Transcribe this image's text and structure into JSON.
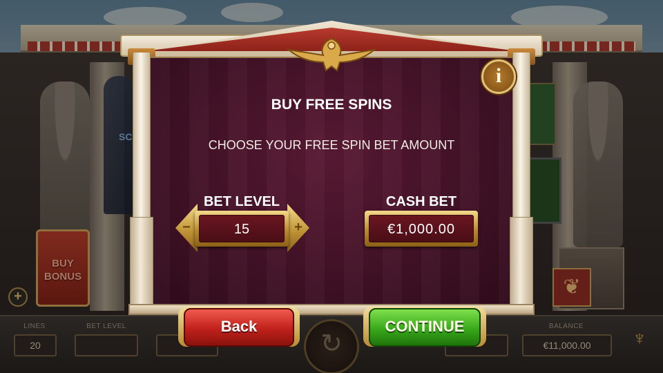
{
  "dialog": {
    "title": "BUY FREE SPINS",
    "subtitle": "CHOOSE YOUR FREE SPIN BET AMOUNT",
    "bet_level": {
      "label": "BET LEVEL",
      "value": "15",
      "decrease_icon": "minus-icon",
      "increase_icon": "plus-icon",
      "decrease_glyph": "−",
      "increase_glyph": "+"
    },
    "cash_bet": {
      "label": "CASH BET",
      "value": "€1,000.00"
    },
    "info_glyph": "i",
    "buttons": {
      "back": "Back",
      "continue": "CONTINUE"
    }
  },
  "game": {
    "buy_bonus_label": "BUY\nBONUS",
    "left_banner_text": "SC"
  },
  "status_bar": {
    "lines_label": "LINES",
    "lines_value": "20",
    "bet_level_label": "BET LEVEL",
    "balance_label": "BALANCE",
    "balance_value": "€11,000.00"
  },
  "colors": {
    "panel": "#3d1024",
    "gold": "#c19638",
    "back_button": "#c0201a",
    "continue_button": "#37a81a"
  }
}
